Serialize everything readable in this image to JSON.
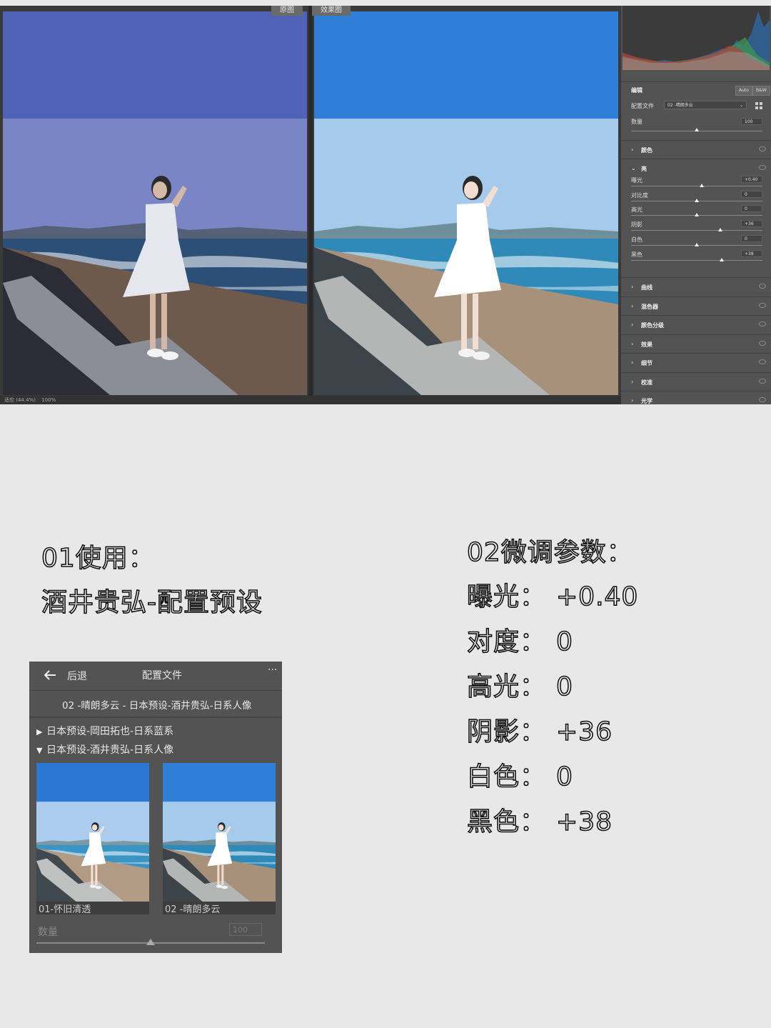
{
  "editor": {
    "view_labels": {
      "before": "原图",
      "after": "效果图"
    },
    "status": {
      "zoom_label": "适应 (44.4%)",
      "zoom_value": "100%"
    },
    "panel": {
      "section_title": "编辑",
      "buttons": {
        "auto": "Auto",
        "bw": "B&W"
      },
      "profile": {
        "label": "配置文件",
        "value": "02 -晴朗多云"
      },
      "amount": {
        "label": "数量",
        "value": "100",
        "level": 0.5
      },
      "sections_before": [
        {
          "label": "颜色"
        }
      ],
      "light": {
        "label": "亮",
        "sliders": [
          {
            "label": "曝光",
            "value": "+0.40",
            "level": 0.54
          },
          {
            "label": "对比度",
            "value": "0",
            "level": 0.5
          },
          {
            "label": "高光",
            "value": "0",
            "level": 0.5
          },
          {
            "label": "阴影",
            "value": "+36",
            "level": 0.68
          },
          {
            "label": "白色",
            "value": "0",
            "level": 0.5
          },
          {
            "label": "黑色",
            "value": "+38",
            "level": 0.69
          }
        ]
      },
      "sections_after": [
        {
          "label": "曲线"
        },
        {
          "label": "混色器"
        },
        {
          "label": "颜色分级"
        },
        {
          "label": "效果"
        },
        {
          "label": "细节"
        },
        {
          "label": "校准"
        },
        {
          "label": "光学"
        }
      ]
    }
  },
  "explainer": {
    "step1": {
      "heading": "01使用：",
      "preset": "酒井贵弘-配置预设"
    },
    "step2": {
      "heading": "02微调参数：",
      "params": [
        {
          "name": "曝光：",
          "value": "+0.40"
        },
        {
          "name": "对度：",
          "value": "0"
        },
        {
          "name": "高光：",
          "value": "0"
        },
        {
          "name": "阴影：",
          "value": "+36"
        },
        {
          "name": "白色：",
          "value": "0"
        },
        {
          "name": "黑色：",
          "value": "+38"
        }
      ]
    }
  },
  "profile_browser": {
    "back_label": "后退",
    "title": "配置文件",
    "more": "···",
    "current": "02 -晴朗多云 - 日本预设-酒井贵弘-日系人像",
    "groups": [
      {
        "label": "日本预设-岡田拓也-日系蓝系",
        "expanded": false
      },
      {
        "label": "日本预设-酒井贵弘-日系人像",
        "expanded": true
      }
    ],
    "thumbnails": [
      {
        "caption": "01-怀旧清透"
      },
      {
        "caption": "02 -晴朗多云"
      }
    ],
    "amount": {
      "label": "数量",
      "value": "100",
      "level": 0.5
    }
  }
}
